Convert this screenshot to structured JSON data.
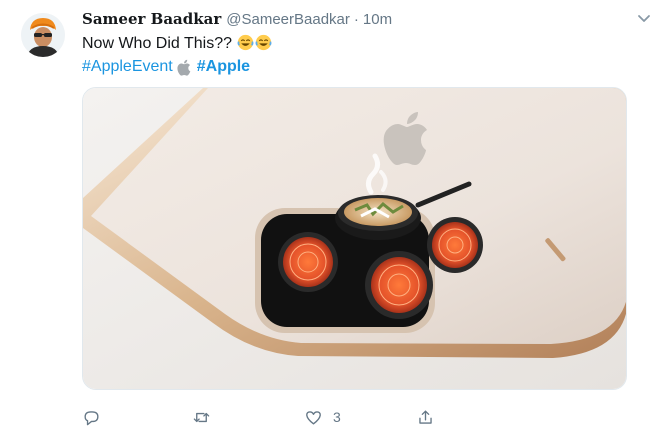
{
  "tweet": {
    "author_name": "Sameer Baadkar",
    "handle": "@SameerBaadkar",
    "separator": "·",
    "time": "10m",
    "text": "Now Who Did This??",
    "emojis": [
      "joy-emoji",
      "joy-emoji"
    ],
    "hashtags": [
      {
        "label": "#AppleEvent",
        "bold": false
      },
      {
        "label": "#Apple",
        "bold": true
      }
    ],
    "media_description_icon": "apple-logo-icon"
  },
  "actions": {
    "reply": {
      "icon": "reply-icon",
      "count": ""
    },
    "retweet": {
      "icon": "retweet-icon",
      "count": ""
    },
    "like": {
      "icon": "heart-icon",
      "count": "3"
    },
    "share": {
      "icon": "share-icon",
      "count": ""
    }
  },
  "colors": {
    "link": "#1b95e0",
    "muted": "#657786",
    "text": "#14171a",
    "burner": "#e4522a"
  }
}
